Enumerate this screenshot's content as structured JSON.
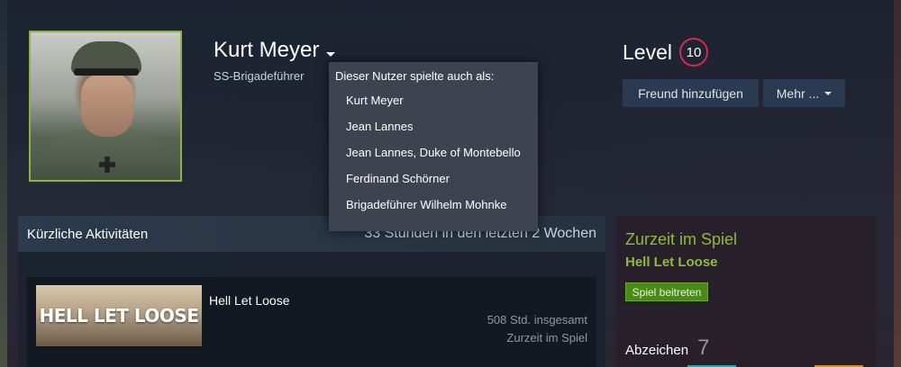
{
  "profile": {
    "persona_name": "Kurt Meyer",
    "real_name": "SS-Brigadeführer"
  },
  "aliases_dropdown": {
    "title": "Dieser Nutzer spielte auch als:",
    "items": [
      "Kurt Meyer",
      "Jean Lannes",
      "Jean Lannes, Duke of Montebello",
      "Ferdinand Schörner",
      "Brigadeführer Wilhelm Mohnke"
    ]
  },
  "level": {
    "label": "Level",
    "value": "10"
  },
  "actions": {
    "add_friend": "Freund hinzufügen",
    "more": "Mehr ..."
  },
  "recent_activity": {
    "title": "Kürzliche Aktivitäten",
    "hours": "33 Stunden in den letzten 2 Wochen",
    "game": {
      "capsule_text": "HELL LET LOOSE",
      "name": "Hell Let Loose",
      "total": "508 Std. insgesamt",
      "status": "Zurzeit im Spiel"
    }
  },
  "sidebar": {
    "in_game_title": "Zurzeit im Spiel",
    "in_game_name": "Hell Let Loose",
    "join_button": "Spiel beitreten",
    "badges_label": "Abzeichen",
    "badges_count": "7"
  },
  "colors": {
    "accent_green": "#90ba3c",
    "level_ring": "#d12a4a",
    "button_bg": "#2a3a50"
  }
}
